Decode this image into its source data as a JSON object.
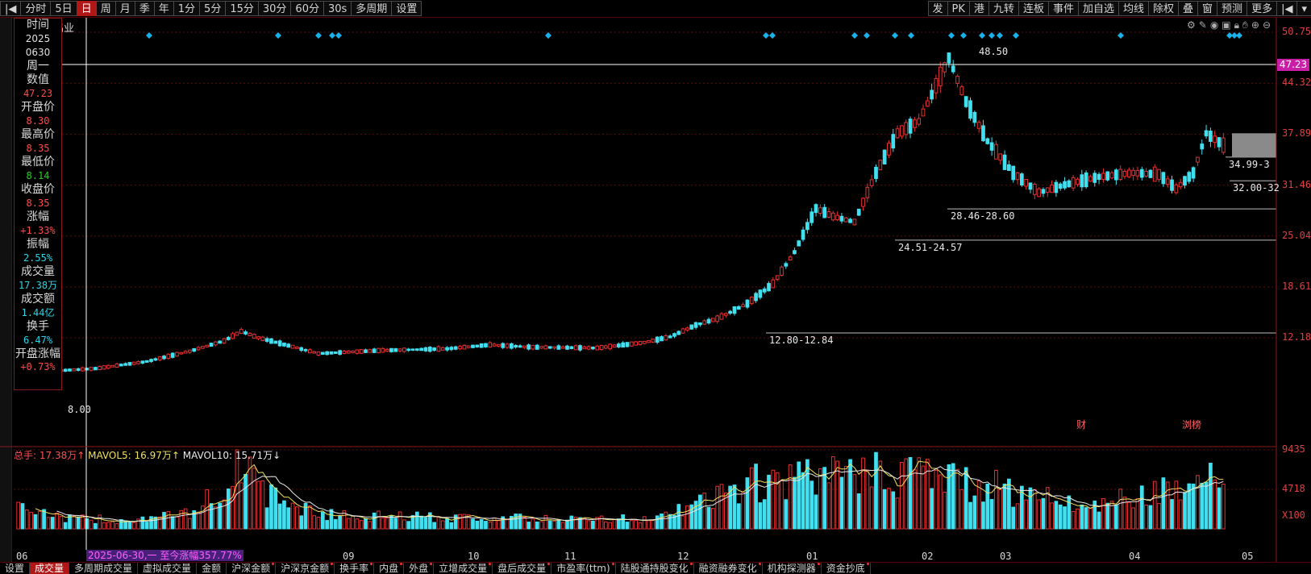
{
  "toolbar": {
    "items": [
      "分时",
      "5日",
      "日",
      "周",
      "月",
      "季",
      "年",
      "1分",
      "5分",
      "15分",
      "30分",
      "60分",
      "30s",
      "多周期",
      "设置"
    ],
    "active": "日",
    "right_items": [
      "发",
      "PK",
      "港",
      "九转",
      "连板",
      "事件",
      "加自选",
      "均线",
      "除权",
      "叠",
      "窗",
      "预测",
      "更多"
    ]
  },
  "title_fragment": "鸣业",
  "info_panel": [
    {
      "label": "时间",
      "values": [
        "2025",
        "0630",
        "周一"
      ],
      "color": "white"
    },
    {
      "label": "数值",
      "values": [
        "47.23"
      ],
      "color": "red"
    },
    {
      "label": "开盘价",
      "values": [
        "8.30"
      ],
      "color": "red"
    },
    {
      "label": "最高价",
      "values": [
        "8.35"
      ],
      "color": "red"
    },
    {
      "label": "最低价",
      "values": [
        "8.14"
      ],
      "color": "green"
    },
    {
      "label": "收盘价",
      "values": [
        "8.35"
      ],
      "color": "red"
    },
    {
      "label": "涨幅",
      "values": [
        "+1.33%"
      ],
      "color": "red"
    },
    {
      "label": "振幅",
      "values": [
        "2.55%"
      ],
      "color": "cyan"
    },
    {
      "label": "成交量",
      "values": [
        "17.38万"
      ],
      "color": "cyan"
    },
    {
      "label": "成交额",
      "values": [
        "1.44亿"
      ],
      "color": "cyan"
    },
    {
      "label": "换手",
      "values": [
        "6.47%"
      ],
      "color": "cyan"
    },
    {
      "label": "开盘涨幅",
      "values": [
        "+0.73%"
      ],
      "color": "red"
    }
  ],
  "price_axis": [
    "50.75",
    "44.32",
    "37.89",
    "31.46",
    "25.04",
    "18.61",
    "12.18"
  ],
  "current_price": "47.23",
  "volume_axis": [
    "9435",
    "4718",
    "X100"
  ],
  "volume_legend": {
    "total": "总手: 17.38万↑",
    "mavol5": "MAVOL5: 16.97万↑",
    "mavol10": "MAVOL10: 15.71万↓"
  },
  "x_labels": [
    "06",
    "09",
    "10",
    "11",
    "12",
    "01",
    "02",
    "03",
    "04",
    "05"
  ],
  "range_label": "2025-06-30,一 至今涨幅357.77%",
  "annotations": {
    "high": "48.50",
    "low": "8.00",
    "levels": [
      "34.99-3",
      "32.00-32",
      "28.46-28.60",
      "24.51-24.57",
      "12.80-12.84"
    ],
    "markers": [
      "财",
      "浏榜"
    ]
  },
  "bottom_tabs": [
    "设置",
    "成交量",
    "多周期成交量",
    "虚拟成交量",
    "金额",
    "沪深金额",
    "沪深京金额",
    "换手率",
    "内盘",
    "外盘",
    "立增成交量",
    "盘后成交量",
    "市盈率(ttm)",
    "陆股通持股变化",
    "融资融券变化",
    "机构探测器",
    "资金抄底"
  ],
  "bottom_active": "成交量",
  "colors": {
    "up": "#e83030",
    "down": "#40e0f0",
    "grid": "#5a0c0c",
    "crosshair": "#ffffff",
    "ma5": "#f0e060",
    "ma10": "#e8e8e8"
  },
  "price_range": {
    "min": 7.0,
    "max": 50.75
  },
  "volume_range": {
    "min": 0,
    "max": 9435
  },
  "candle_count": 165,
  "price_anchors": [
    [
      0,
      8.8
    ],
    [
      8,
      8.0
    ],
    [
      18,
      8.3
    ],
    [
      30,
      9.2
    ],
    [
      40,
      10.5
    ],
    [
      48,
      11.8
    ],
    [
      52,
      13.0
    ],
    [
      56,
      12.2
    ],
    [
      70,
      10.2
    ],
    [
      85,
      10.6
    ],
    [
      100,
      10.8
    ],
    [
      110,
      11.3
    ],
    [
      120,
      11.0
    ],
    [
      135,
      10.9
    ],
    [
      146,
      11.6
    ],
    [
      152,
      12.3
    ],
    [
      158,
      13.8
    ],
    [
      163,
      14.6
    ],
    [
      170,
      16.5
    ],
    [
      176,
      19.0
    ],
    [
      181,
      23.0
    ],
    [
      186,
      28.5
    ],
    [
      190,
      27.5
    ],
    [
      195,
      26.8
    ],
    [
      200,
      33.0
    ],
    [
      205,
      38.0
    ],
    [
      210,
      39.5
    ],
    [
      214,
      44.0
    ],
    [
      217,
      47.5
    ],
    [
      221,
      42.0
    ],
    [
      226,
      37.0
    ],
    [
      232,
      33.0
    ],
    [
      238,
      30.5
    ],
    [
      244,
      31.5
    ],
    [
      252,
      32.5
    ],
    [
      260,
      33.0
    ],
    [
      266,
      32.8
    ],
    [
      270,
      31.0
    ],
    [
      274,
      33.0
    ],
    [
      277,
      38.0
    ],
    [
      281,
      36.5
    ]
  ],
  "volume_anchors": [
    [
      0,
      3200
    ],
    [
      10,
      1200
    ],
    [
      25,
      1100
    ],
    [
      40,
      1700
    ],
    [
      48,
      5200
    ],
    [
      52,
      8200
    ],
    [
      58,
      4000
    ],
    [
      70,
      1700
    ],
    [
      90,
      1400
    ],
    [
      110,
      1300
    ],
    [
      130,
      1100
    ],
    [
      150,
      1300
    ],
    [
      160,
      3200
    ],
    [
      170,
      5300
    ],
    [
      180,
      5600
    ],
    [
      190,
      6200
    ],
    [
      200,
      6500
    ],
    [
      210,
      6800
    ],
    [
      220,
      5600
    ],
    [
      235,
      4200
    ],
    [
      250,
      2800
    ],
    [
      265,
      4100
    ],
    [
      275,
      7400
    ],
    [
      281,
      5000
    ]
  ]
}
